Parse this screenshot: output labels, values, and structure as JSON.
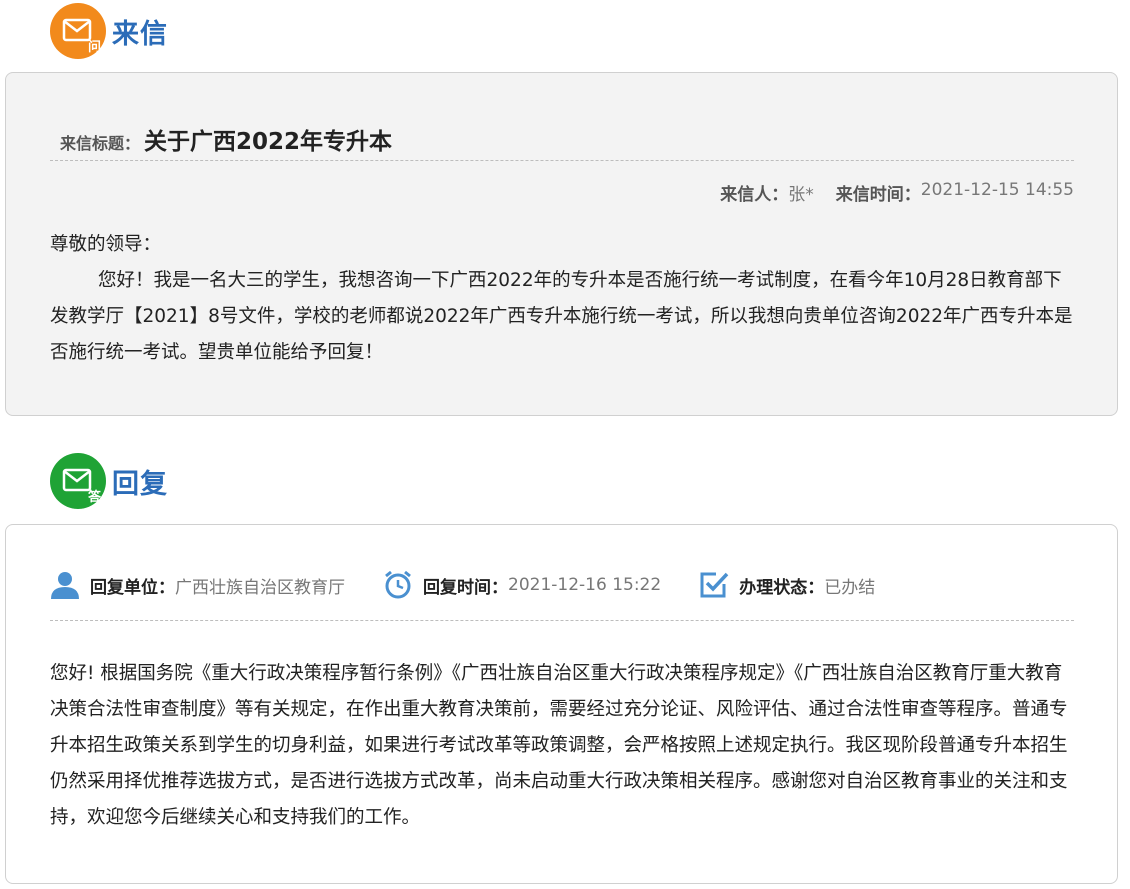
{
  "letter": {
    "heading": "来信",
    "icon_mark": "问",
    "title_label": "来信标题：",
    "title": "关于广西2022年专升本",
    "sender_label": "来信人：",
    "sender": "张*",
    "time_label": "来信时间：",
    "time": "2021-12-15 14:55",
    "greeting": "尊敬的领导：",
    "body": "您好！我是一名大三的学生，我想咨询一下广西2022年的专升本是否施行统一考试制度，在看今年10月28日教育部下发教学厅【2021】8号文件，学校的老师都说2022年广西专升本施行统一考试，所以我想向贵单位咨询2022年广西专升本是否施行统一考试。望贵单位能给予回复！"
  },
  "reply": {
    "heading": "回复",
    "icon_mark": "答",
    "unit_label": "回复单位：",
    "unit": "广西壮族自治区教育厅",
    "time_label": "回复时间：",
    "time": "2021-12-16 15:22",
    "status_label": "办理状态：",
    "status": "已办结",
    "body": "您好! 根据国务院《重大行政决策程序暂行条例》《广西壮族自治区重大行政决策程序规定》《广西壮族自治区教育厅重大教育决策合法性审查制度》等有关规定，在作出重大教育决策前，需要经过充分论证、风险评估、通过合法性审查等程序。普通专升本招生政策关系到学生的切身利益，如果进行考试改革等政策调整，会严格按照上述规定执行。我区现阶段普通专升本招生仍然采用择优推荐选拔方式，是否进行选拔方式改革，尚未启动重大行政决策相关程序。感谢您对自治区教育事业的关注和支持，欢迎您今后继续关心和支持我们的工作。"
  },
  "colors": {
    "accent": "#2b6cb8",
    "orange": "#f28a1c",
    "green": "#1fa335",
    "icon_blue": "#4a90d0"
  },
  "icons": [
    "letter-question-icon",
    "letter-answer-icon",
    "user-icon",
    "alarm-clock-icon",
    "checkbox-icon"
  ]
}
